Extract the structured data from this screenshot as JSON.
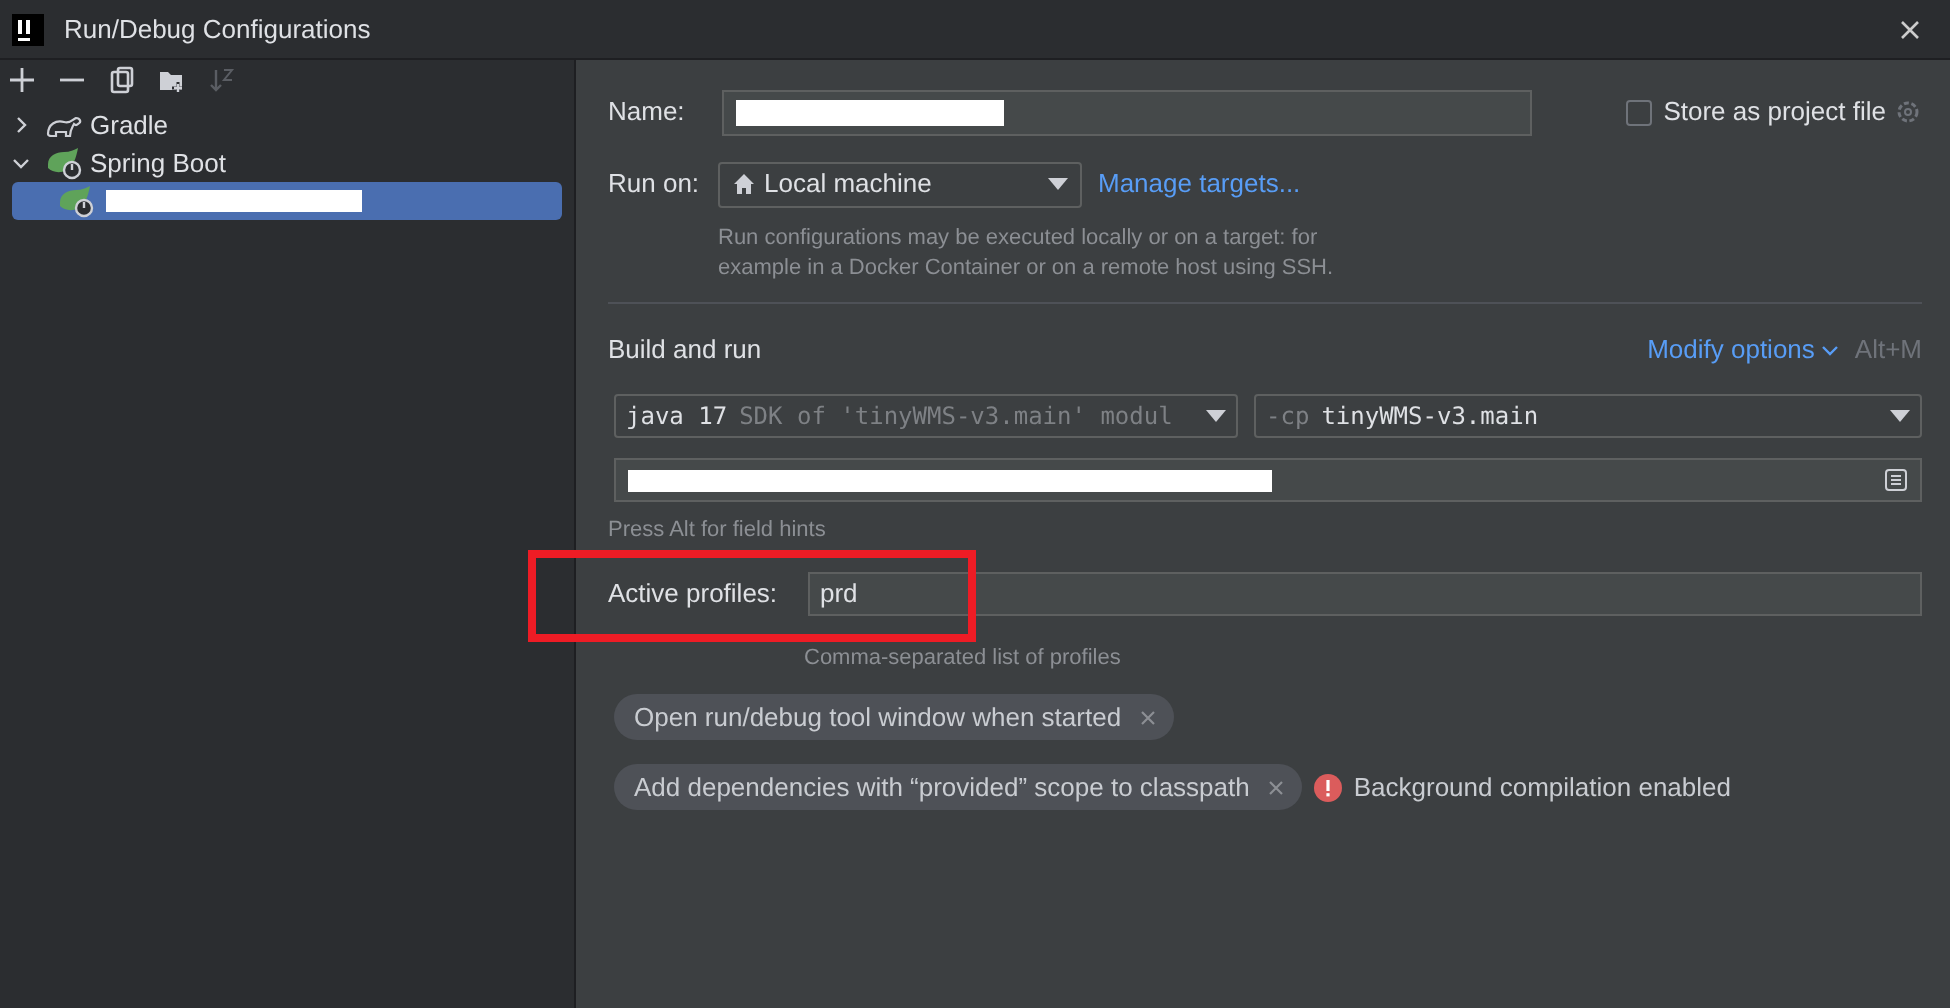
{
  "window": {
    "title": "Run/Debug Configurations"
  },
  "toolbar": {
    "buttons": [
      {
        "kind": "add",
        "disabled": false
      },
      {
        "kind": "remove",
        "disabled": false
      },
      {
        "kind": "copy",
        "disabled": false
      },
      {
        "kind": "folder",
        "disabled": false
      },
      {
        "kind": "sort",
        "disabled": true
      }
    ]
  },
  "tree": [
    {
      "label": "Gradle",
      "kind": "gradle",
      "expanded": false,
      "selected": false
    },
    {
      "label": "Spring Boot",
      "kind": "spring",
      "expanded": true,
      "selected": false,
      "children": [
        {
          "kind": "spring",
          "redacted": true,
          "selected": true
        }
      ]
    }
  ],
  "form": {
    "name": {
      "label": "Name:",
      "redacted": true
    },
    "store_as_project_file": {
      "label": "Store as project file",
      "checked": false
    },
    "run_on": {
      "label": "Run on:",
      "value": "Local machine",
      "link": "Manage targets...",
      "hint": "Run configurations may be executed locally or on a target: for example in a Docker Container or on a remote host using SSH."
    },
    "section": {
      "title": "Build and run",
      "link": "Modify options",
      "shortcut": "Alt+M"
    },
    "jdk": {
      "value": "java 17",
      "detail": "SDK of 'tinyWMS-v3.main' modul"
    },
    "classpath": {
      "prefix": "-cp",
      "value": "tinyWMS-v3.main"
    },
    "main_class": {
      "redacted": true
    },
    "field_hint": "Press Alt for field hints",
    "active_profiles": {
      "label": "Active profiles:",
      "value": "prd",
      "hint": "Comma-separated list of profiles"
    },
    "options": [
      {
        "label": "Open run/debug tool window when started"
      },
      {
        "label": "Add dependencies with “provided” scope to classpath",
        "warning": "Background compilation enabled"
      }
    ]
  },
  "annotation": {
    "kind": "highlight",
    "color": "#ee1c25"
  }
}
